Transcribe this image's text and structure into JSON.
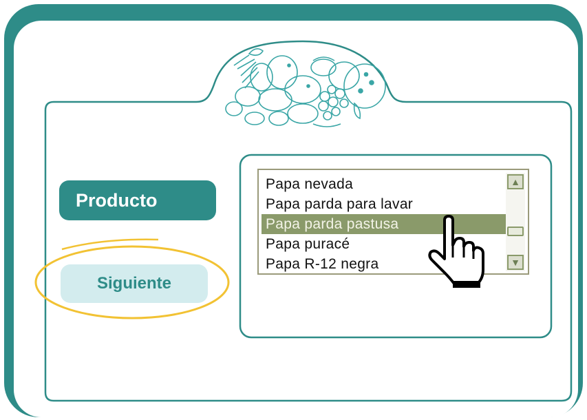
{
  "buttons": {
    "producto": "Producto",
    "siguiente": "Siguiente"
  },
  "listbox": {
    "items": [
      {
        "label": "Papa nevada",
        "selected": false
      },
      {
        "label": "Papa parda para lavar",
        "selected": false
      },
      {
        "label": "Papa parda pastusa",
        "selected": true
      },
      {
        "label": "Papa puracé",
        "selected": false
      },
      {
        "label": "Papa R-12 negra",
        "selected": false
      }
    ]
  },
  "icons": {
    "header": "fruits-vegetables-illustration",
    "scroll_up": "chevron-up-icon",
    "scroll_down": "chevron-down-icon",
    "cursor": "hand-pointer-icon"
  },
  "colors": {
    "frame": "#2e8c88",
    "button_primary": "#2e8c88",
    "button_secondary_bg": "#d3ecee",
    "selection": "#8a9a6a",
    "highlight_ellipse": "#f2c233"
  }
}
